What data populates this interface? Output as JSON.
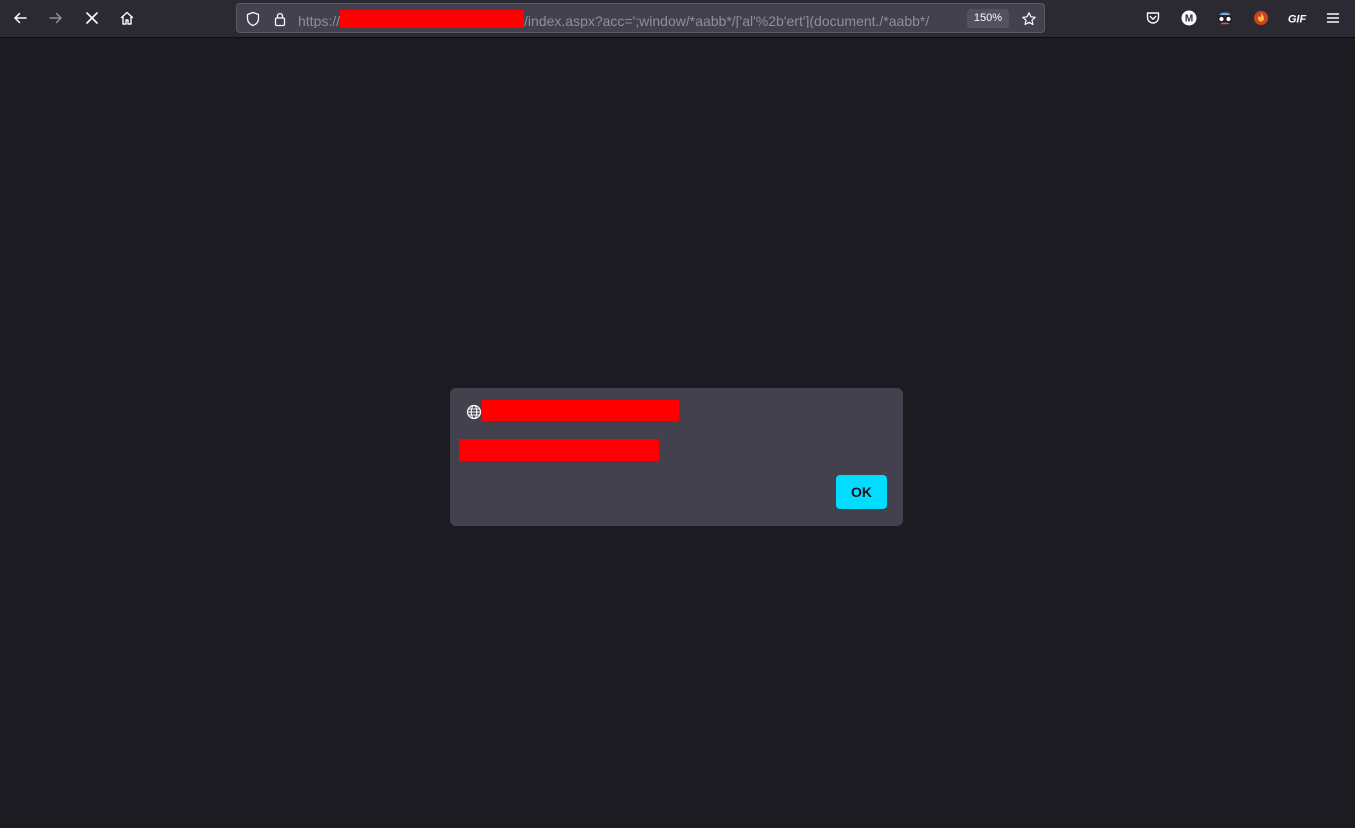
{
  "browser": {
    "url": {
      "scheme_prefix": "https://",
      "visible_suffix": "/index.aspx?acc=';window/*aabb*/['al'%2b'ert'](document./*aabb*/",
      "redacted": true
    },
    "zoom_label": "150%",
    "nav_icons": [
      "back-arrow-icon",
      "forward-arrow-icon",
      "stop-icon",
      "home-icon"
    ],
    "urlbar_icons": [
      "shield-icon",
      "lock-icon",
      "bookmark-star-icon"
    ],
    "extension_icons": [
      "pocket-icon",
      "extension-m-icon",
      "extension-glasses-icon",
      "extension-fire-icon",
      "extension-gif-icon",
      "hamburger-menu-icon"
    ],
    "extension_gif_label": "GIF",
    "extension_m_label": "M"
  },
  "dialog": {
    "title_redacted": true,
    "message_redacted": true,
    "ok_label": "OK"
  },
  "colors": {
    "page_background": "#1c1b22",
    "toolbar_background": "#2b2a33",
    "dialog_background": "#42414d",
    "ok_button": "#00ddff",
    "redaction": "#ff0000"
  }
}
